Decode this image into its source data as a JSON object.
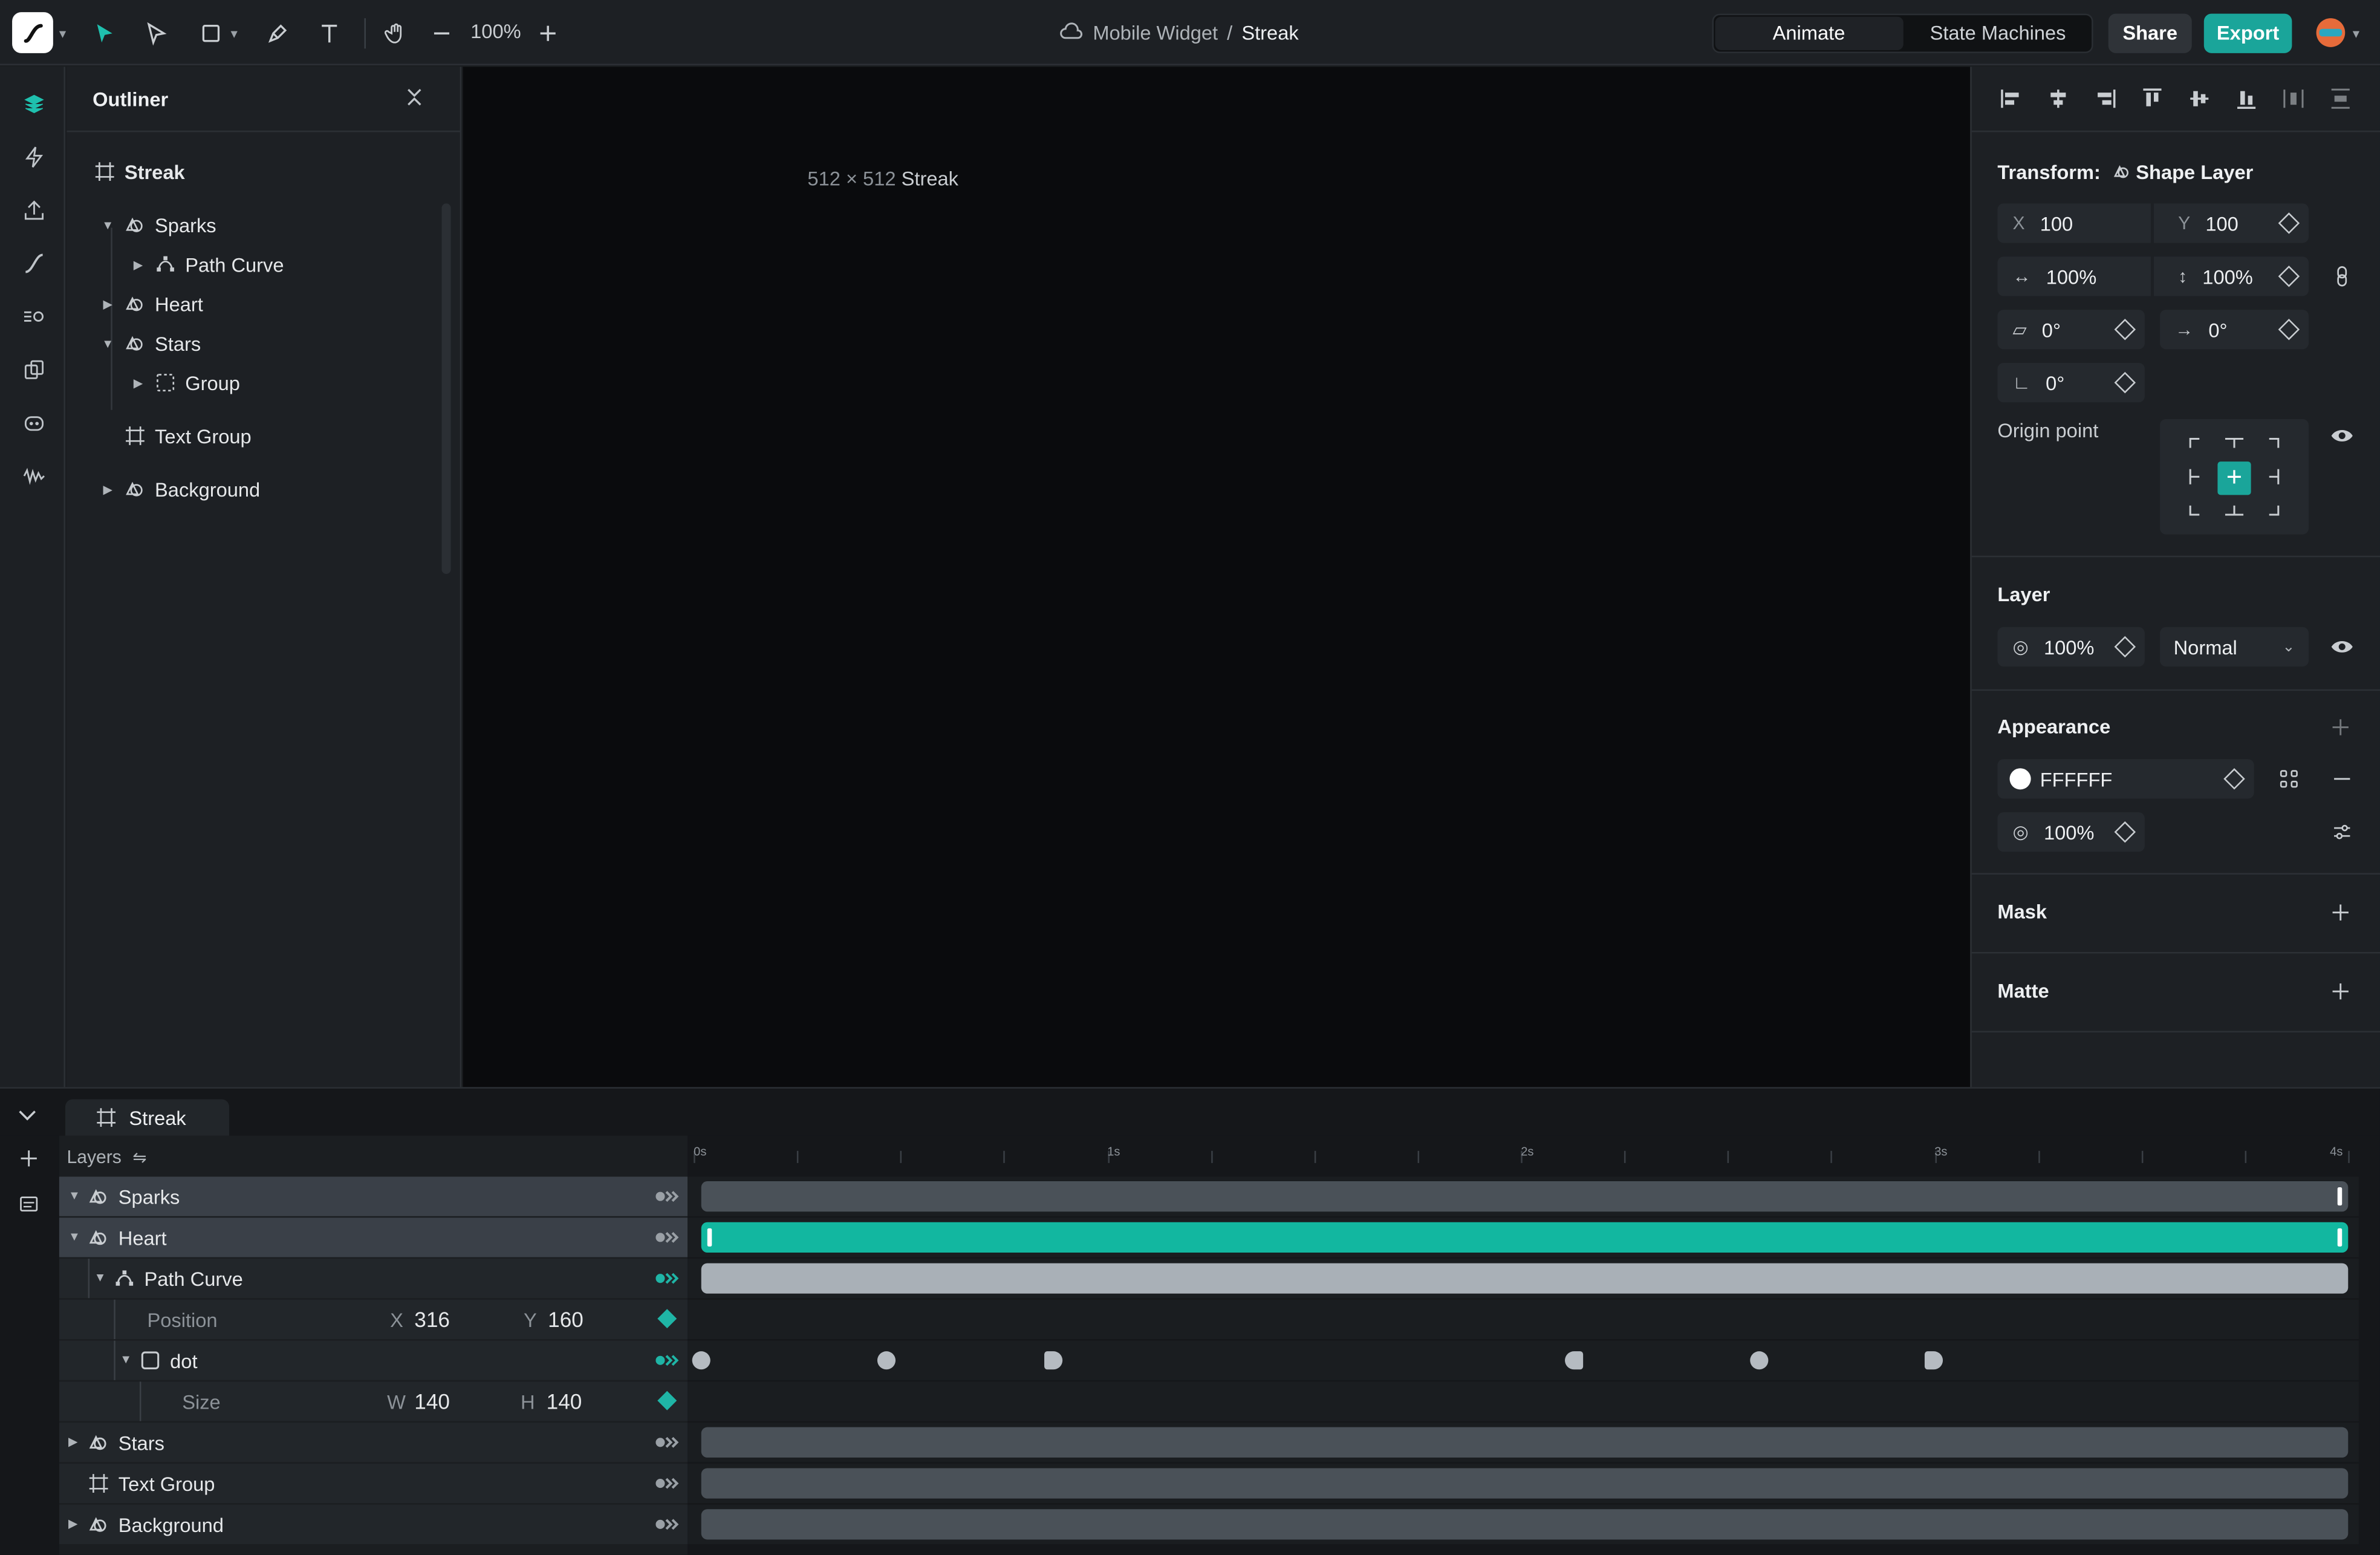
{
  "toolbar": {
    "zoom": "100%",
    "breadcrumb_project": "Mobile Widget",
    "breadcrumb_sep": "/",
    "breadcrumb_file": "Streak",
    "mode_animate": "Animate",
    "mode_state_machines": "State Machines",
    "share_label": "Share",
    "export_label": "Export",
    "accent_color": "#1aa59a"
  },
  "outliner": {
    "title": "Outliner",
    "root": "Streak",
    "items": [
      {
        "label": "Sparks",
        "icon": "shape-icon"
      },
      {
        "label": "Path Curve",
        "icon": "path-icon"
      },
      {
        "label": "Heart",
        "icon": "shape-icon"
      },
      {
        "label": "Stars",
        "icon": "shape-icon"
      },
      {
        "label": "Group",
        "icon": "group-icon"
      },
      {
        "label": "Text Group",
        "icon": "artboard-icon"
      },
      {
        "label": "Background",
        "icon": "shape-icon"
      }
    ]
  },
  "canvas": {
    "size_label": "512 × 512",
    "artboard_name": "Streak"
  },
  "inspector": {
    "transform_title": "Transform:",
    "transform_type": "Shape Layer",
    "x_label": "X",
    "x_value": "100",
    "y_label": "Y",
    "y_value": "100",
    "scale_x": "100%",
    "scale_y": "100%",
    "skew": "0°",
    "rotation": "0°",
    "angle": "0°",
    "origin_label": "Origin point",
    "layer_title": "Layer",
    "layer_opacity": "100%",
    "blend_mode": "Normal",
    "appearance_title": "Appearance",
    "fill_color_hex": "FFFFFF",
    "fill_opacity": "100%",
    "mask_title": "Mask",
    "matte_title": "Matte"
  },
  "timeline": {
    "tab_label": "Streak",
    "layers_header": "Layers",
    "ruler_labels": [
      "0s",
      "1s",
      "2s",
      "3s",
      "4s"
    ],
    "rows": [
      {
        "label": "Sparks"
      },
      {
        "label": "Heart"
      },
      {
        "label": "Path Curve"
      },
      {
        "label": "Position",
        "x_label": "X",
        "x_value": "316",
        "y_label": "Y",
        "y_value": "160"
      },
      {
        "label": "dot"
      },
      {
        "label": "Size",
        "w_label": "W",
        "w_value": "140",
        "h_label": "H",
        "h_value": "140"
      },
      {
        "label": "Stars"
      },
      {
        "label": "Text Group"
      },
      {
        "label": "Background"
      }
    ]
  }
}
